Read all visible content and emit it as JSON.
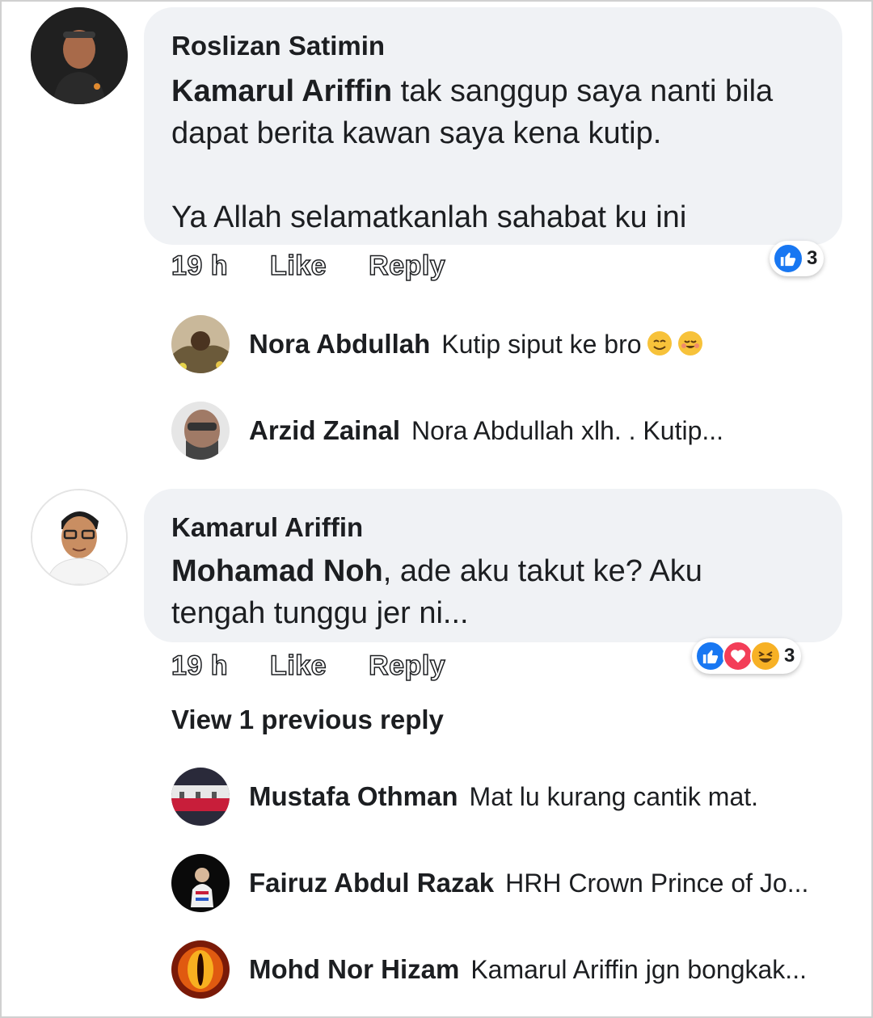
{
  "comments": [
    {
      "author": "Roslizan Satimin",
      "mention": "Kamarul Ariffin",
      "text_line1": " tak sanggup saya nanti bila",
      "text_line2": "dapat berita kawan saya kena kutip.",
      "text_line3": "Ya Allah selamatkanlah sahabat ku ini",
      "time": "19 h",
      "like_label": "Like",
      "reply_label": "Reply",
      "reactions": [
        "like-icon"
      ],
      "reaction_count": "3",
      "replies": [
        {
          "author": "Nora Abdullah",
          "text": "Kutip siput ke bro"
        },
        {
          "author": "Arzid Zainal",
          "text": "Nora Abdullah xlh.  . Kutip..."
        }
      ]
    },
    {
      "author": "Kamarul Ariffin",
      "mention": "Mohamad Noh",
      "text_line1": ", ade aku takut ke? Aku",
      "text_line2": "tengah tunggu jer ni...",
      "time": "19 h",
      "like_label": "Like",
      "reply_label": "Reply",
      "reactions": [
        "like-icon",
        "love-icon",
        "haha-icon"
      ],
      "reaction_count": "3",
      "view_previous": "View 1 previous reply",
      "replies": [
        {
          "author": "Mustafa Othman",
          "text": "Mat lu kurang cantik mat."
        },
        {
          "author": "Fairuz Abdul Razak",
          "text": "HRH Crown Prince of Jo..."
        },
        {
          "author": "Mohd Nor Hizam",
          "text": "Kamarul Ariffin jgn bongkak..."
        }
      ]
    }
  ],
  "colors": {
    "bubble": "#f0f2f5",
    "like_blue": "#1877f2",
    "love_red": "#f33e58",
    "haha_yellow": "#f7b125"
  }
}
